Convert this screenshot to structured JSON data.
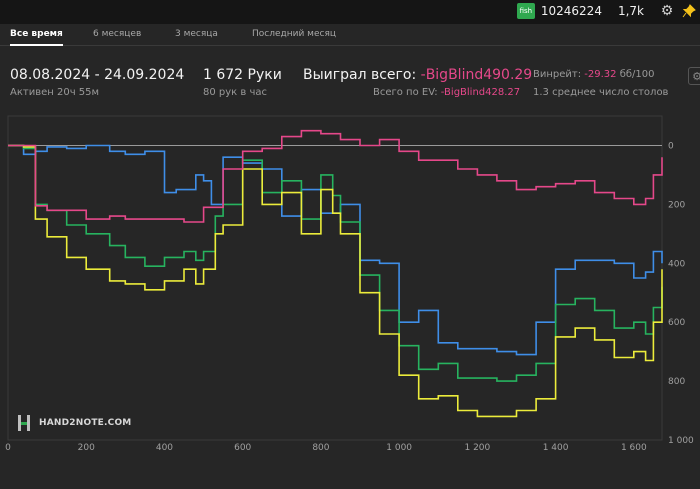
{
  "user": {
    "site_badge": "fish",
    "account_id": "10246224",
    "count": "1,7k",
    "settings_icon": "gear-icon",
    "pin_icon": "pin-icon"
  },
  "tabs": [
    {
      "label": "Все время",
      "active": true
    },
    {
      "label": "6 месяцев",
      "active": false
    },
    {
      "label": "3 месяца",
      "active": false
    },
    {
      "label": "Последний месяц",
      "active": false
    }
  ],
  "stats": {
    "date_range": "08.08.2024 - 24.09.2024",
    "active_time": "Активен 20ч 55м",
    "hands": "1 672 Руки",
    "hands_per_hour": "80 рук в час",
    "won_label": "Выиграл всего:",
    "won_value": "-BigBlind490.29",
    "ev_label": "Всего по EV:",
    "ev_value": "-BigBlind428.27",
    "winrate_label": "Винрейт:",
    "winrate_value": "-29.32",
    "winrate_unit": "бб/100",
    "avg_tables": "1.3 среднее число столов"
  },
  "logo": {
    "text": "HAND2NOTE.COM"
  },
  "colors": {
    "blue": "#3f8ee8",
    "green": "#27b35f",
    "yellow": "#ecec3b",
    "pink": "#e5488a"
  },
  "chart_data": {
    "type": "line",
    "x_range": [
      0,
      1672
    ],
    "y_range": [
      -100,
      1000
    ],
    "y_inverted": true,
    "x_ticks": [
      "0",
      "200",
      "400",
      "600",
      "800",
      "1 000",
      "1 200",
      "1 400",
      "1 600"
    ],
    "x_tick_values": [
      0,
      200,
      400,
      600,
      800,
      1000,
      1200,
      1400,
      1600
    ],
    "y_ticks": [
      "0",
      "200",
      "400",
      "600",
      "800",
      "1 000"
    ],
    "y_tick_values": [
      0,
      200,
      400,
      600,
      800,
      1000
    ],
    "series": [
      {
        "color": "#3f8ee8",
        "x": [
          0,
          40,
          70,
          100,
          150,
          200,
          260,
          300,
          350,
          400,
          430,
          450,
          480,
          500,
          520,
          550,
          600,
          650,
          700,
          750,
          800,
          850,
          900,
          950,
          1000,
          1050,
          1100,
          1150,
          1200,
          1250,
          1300,
          1350,
          1400,
          1450,
          1500,
          1550,
          1600,
          1630,
          1650,
          1672
        ],
        "y": [
          0,
          30,
          20,
          5,
          10,
          0,
          20,
          30,
          20,
          160,
          150,
          150,
          100,
          120,
          200,
          40,
          60,
          80,
          240,
          150,
          230,
          200,
          390,
          400,
          600,
          560,
          670,
          690,
          690,
          700,
          710,
          600,
          420,
          390,
          390,
          400,
          450,
          430,
          360,
          400
        ]
      },
      {
        "color": "#27b35f",
        "x": [
          0,
          40,
          70,
          100,
          150,
          200,
          260,
          300,
          350,
          400,
          450,
          480,
          500,
          530,
          550,
          600,
          650,
          700,
          750,
          800,
          830,
          850,
          900,
          950,
          1000,
          1050,
          1100,
          1150,
          1200,
          1250,
          1300,
          1350,
          1400,
          1450,
          1500,
          1550,
          1600,
          1630,
          1650,
          1672
        ],
        "y": [
          0,
          10,
          200,
          220,
          270,
          300,
          340,
          380,
          410,
          380,
          360,
          390,
          360,
          240,
          200,
          50,
          160,
          120,
          250,
          100,
          170,
          260,
          440,
          560,
          680,
          760,
          740,
          790,
          790,
          800,
          780,
          740,
          540,
          520,
          560,
          620,
          600,
          640,
          550,
          480
        ]
      },
      {
        "color": "#ecec3b",
        "x": [
          0,
          40,
          70,
          100,
          150,
          200,
          260,
          300,
          350,
          400,
          450,
          480,
          500,
          530,
          550,
          600,
          650,
          700,
          750,
          800,
          830,
          850,
          900,
          950,
          1000,
          1050,
          1100,
          1150,
          1200,
          1250,
          1300,
          1350,
          1400,
          1450,
          1500,
          1550,
          1600,
          1630,
          1650,
          1672
        ],
        "y": [
          0,
          5,
          250,
          310,
          380,
          420,
          460,
          470,
          490,
          460,
          420,
          470,
          420,
          300,
          270,
          80,
          200,
          160,
          300,
          150,
          230,
          300,
          500,
          640,
          780,
          860,
          850,
          900,
          920,
          920,
          900,
          860,
          650,
          620,
          660,
          720,
          700,
          730,
          600,
          420
        ]
      },
      {
        "color": "#e5488a",
        "x": [
          0,
          40,
          70,
          100,
          150,
          200,
          260,
          300,
          350,
          400,
          450,
          500,
          550,
          600,
          650,
          700,
          750,
          800,
          850,
          900,
          950,
          1000,
          1050,
          1100,
          1150,
          1200,
          1250,
          1300,
          1350,
          1400,
          1450,
          1500,
          1550,
          1600,
          1630,
          1650,
          1672
        ],
        "y": [
          0,
          0,
          205,
          220,
          220,
          250,
          240,
          250,
          250,
          250,
          260,
          210,
          80,
          20,
          10,
          -30,
          -50,
          -40,
          -20,
          0,
          -20,
          20,
          50,
          50,
          80,
          100,
          120,
          150,
          140,
          130,
          120,
          160,
          180,
          200,
          180,
          100,
          40
        ]
      }
    ]
  }
}
